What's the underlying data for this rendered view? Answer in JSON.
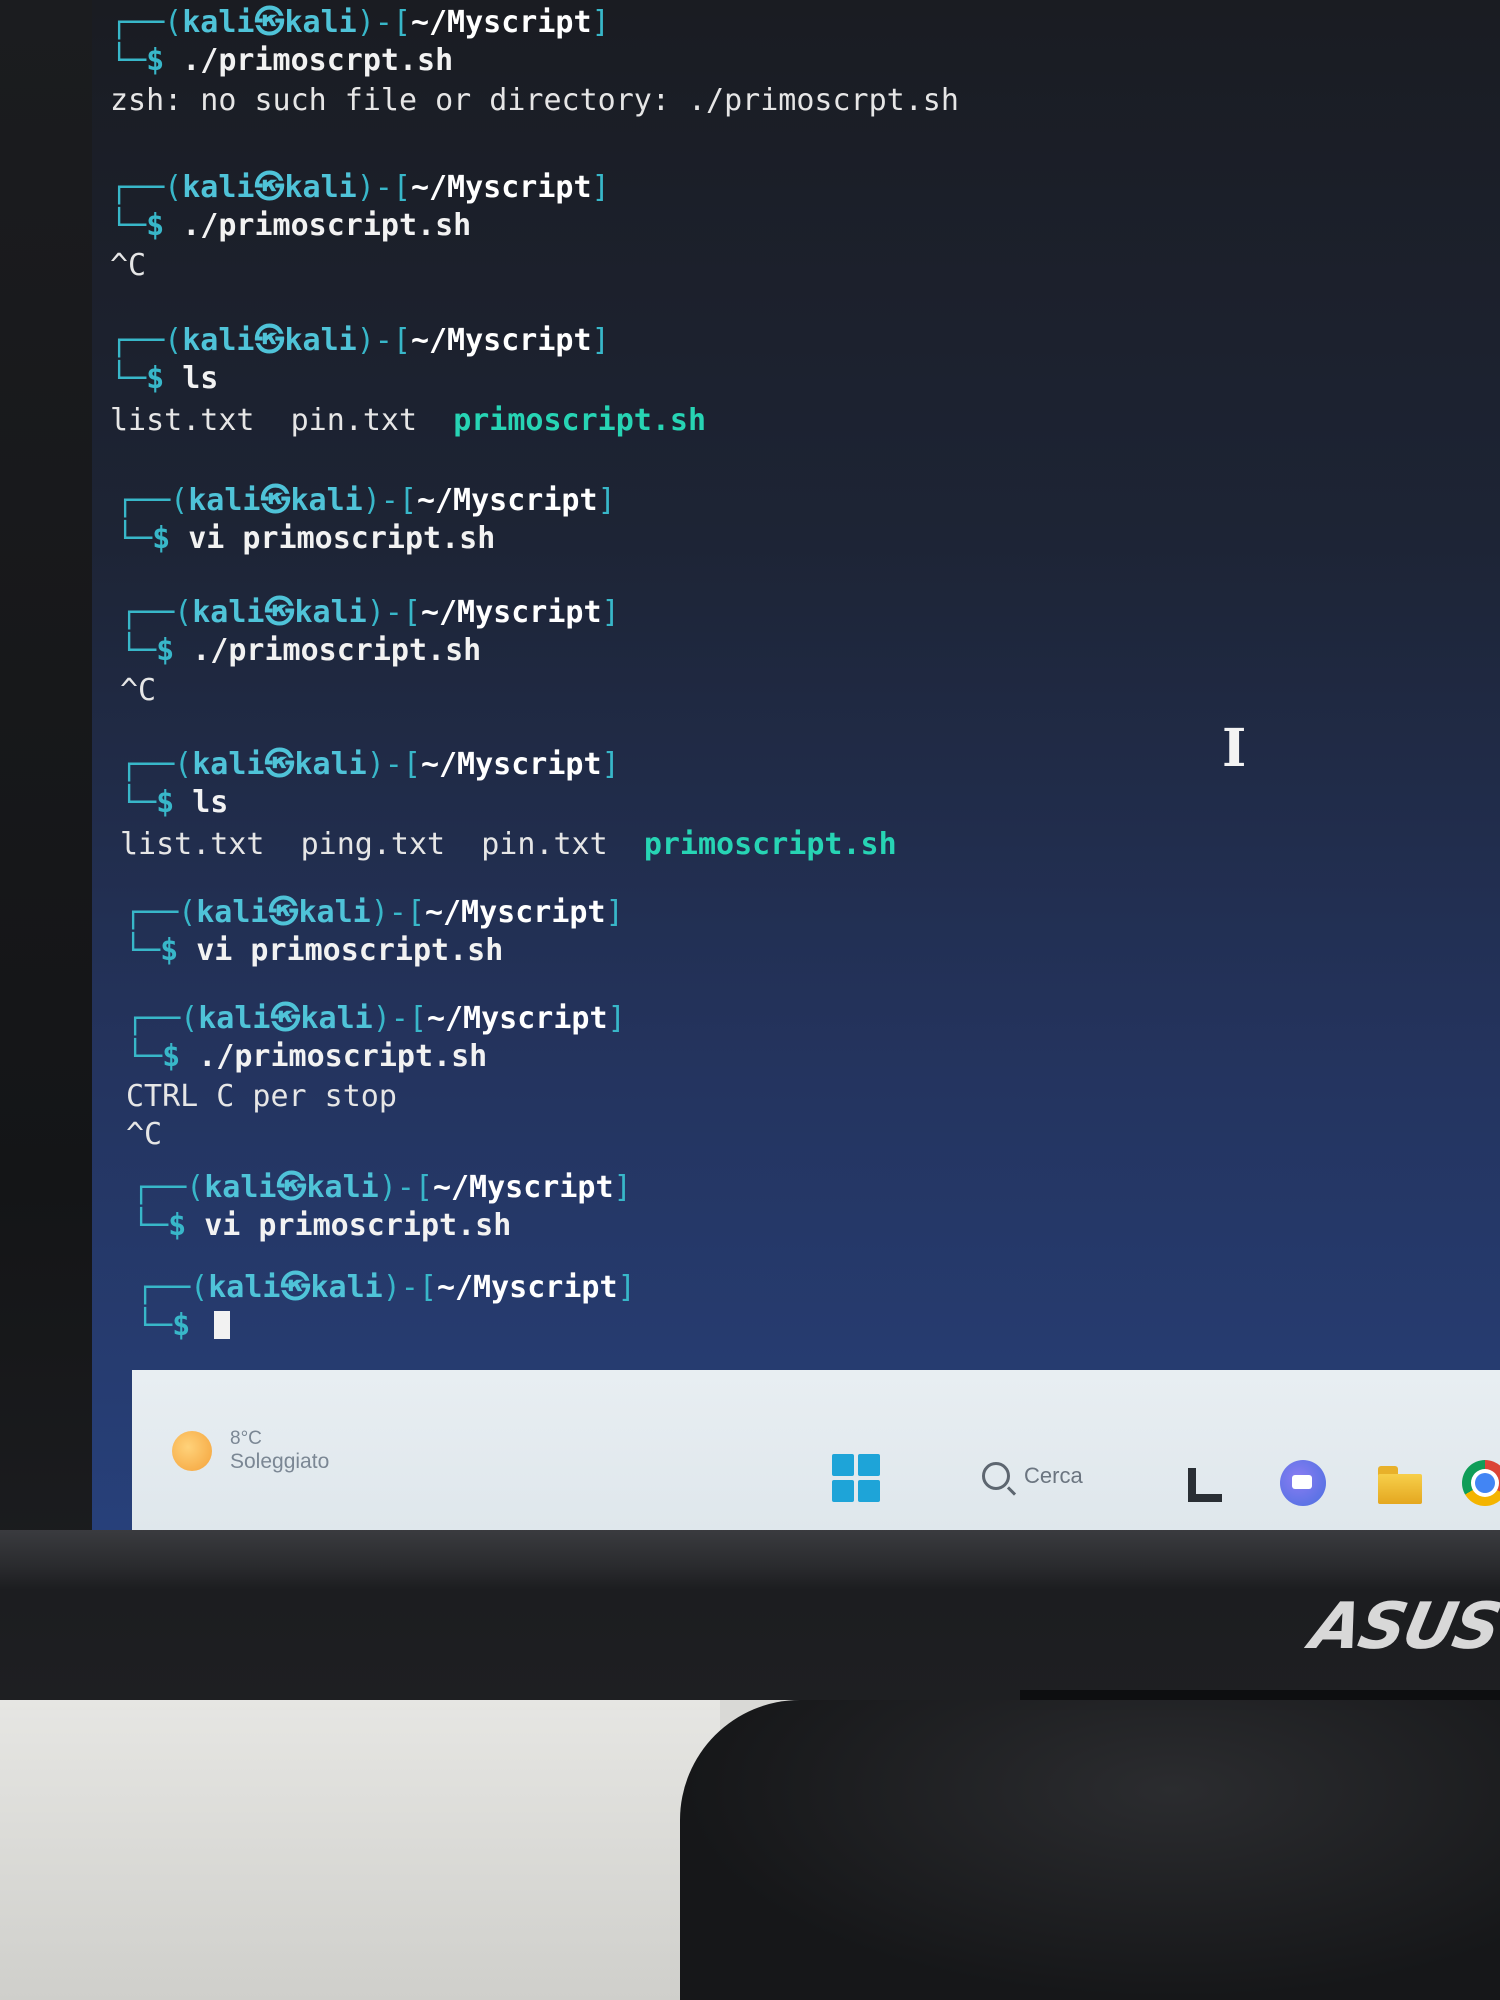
{
  "terminal": {
    "blocks": [
      {
        "prompt_user": "kali",
        "prompt_host": "kali",
        "prompt_dir": "~/Myscript",
        "command": "./primoscrpt.sh",
        "output": [
          "zsh: no such file or directory: ./primoscrpt.sh"
        ]
      },
      {
        "prompt_user": "kali",
        "prompt_host": "kali",
        "prompt_dir": "~/Myscript",
        "command": "./primoscript.sh",
        "output": [
          "^C"
        ]
      },
      {
        "prompt_user": "kali",
        "prompt_host": "kali",
        "prompt_dir": "~/Myscript",
        "command": "ls",
        "files": [
          "list.txt",
          "pin.txt"
        ],
        "exec_files": [
          "primoscript.sh"
        ]
      },
      {
        "prompt_user": "kali",
        "prompt_host": "kali",
        "prompt_dir": "~/Myscript",
        "command": "vi primoscript.sh",
        "output": []
      },
      {
        "prompt_user": "kali",
        "prompt_host": "kali",
        "prompt_dir": "~/Myscript",
        "command": "./primoscript.sh",
        "output": [
          "^C"
        ]
      },
      {
        "prompt_user": "kali",
        "prompt_host": "kali",
        "prompt_dir": "~/Myscript",
        "command": "ls",
        "files": [
          "list.txt",
          "ping.txt",
          "pin.txt"
        ],
        "exec_files": [
          "primoscript.sh"
        ]
      },
      {
        "prompt_user": "kali",
        "prompt_host": "kali",
        "prompt_dir": "~/Myscript",
        "command": "vi primoscript.sh",
        "output": []
      },
      {
        "prompt_user": "kali",
        "prompt_host": "kali",
        "prompt_dir": "~/Myscript",
        "command": "./primoscript.sh",
        "output": [
          "CTRL C per stop",
          "^C"
        ]
      },
      {
        "prompt_user": "kali",
        "prompt_host": "kali",
        "prompt_dir": "~/Myscript",
        "command": "vi primoscript.sh",
        "output": []
      },
      {
        "prompt_user": "kali",
        "prompt_host": "kali",
        "prompt_dir": "~/Myscript",
        "command": "",
        "output": []
      }
    ]
  },
  "taskbar": {
    "weather_temp": "8°C",
    "weather_desc": "Soleggiato",
    "search_label": "Cerca",
    "icons": [
      "start-icon",
      "search-icon",
      "task-view-icon",
      "meet-icon",
      "folder-icon",
      "chrome-icon"
    ]
  },
  "monitor": {
    "brand": "ASUS"
  },
  "colors": {
    "prompt": "#38b7c9",
    "executable": "#27d4b4",
    "screen_bottom": "#27407a"
  }
}
